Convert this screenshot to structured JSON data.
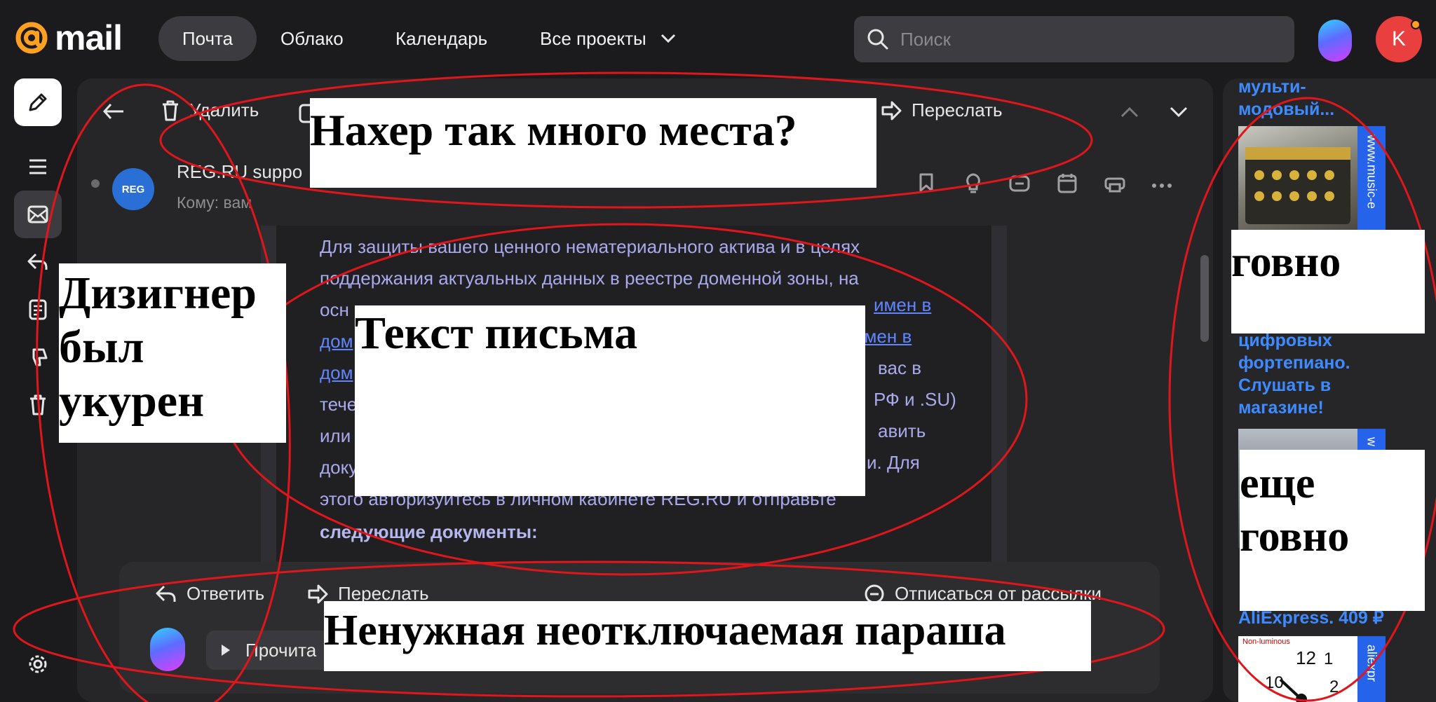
{
  "header": {
    "logo_text": "mail",
    "nav": [
      "Почта",
      "Облако",
      "Календарь",
      "Все проекты"
    ],
    "search_placeholder": "Поиск",
    "avatar_letter": "K"
  },
  "toolbar": {
    "delete_label": "Удалить",
    "forward_label": "Переслать"
  },
  "message": {
    "sender": "REG.RU suppo",
    "recipient": "Кому: вам",
    "sender_badge": "REG",
    "body_lines": [
      {
        "text": "Для защиты вашего ценного нематериального актива и в целях",
        "link": false
      },
      {
        "text": "поддержания актуальных данных в реестре доменной зоны, на",
        "link": false
      },
      {
        "text": "осн",
        "link": false
      },
      {
        "text": "дом",
        "link": true
      },
      {
        "text": "дом",
        "link": true
      },
      {
        "text": "тече",
        "link": false
      },
      {
        "text": "или",
        "link": false
      },
      {
        "text": "доку",
        "link": false
      },
      {
        "text": "этого авторизуйтесь в личном кабинете REG.RU и отправьте",
        "link": false
      }
    ],
    "body_fragments": [
      "имен в",
      "имен в",
      "вас в",
      "РФ и .SU)",
      "авить",
      "и. Для"
    ],
    "body_bold": "следующие документы:"
  },
  "bottom_bar": {
    "reply_label": "Ответить",
    "forward_label": "Переслать",
    "unsubscribe_label": "Отписаться от рассылки",
    "read_label": "Прочита"
  },
  "ads": {
    "ad1_text": "мульти-\nмодовый...",
    "ad1_side": "www.music-e",
    "ad2_text": "цифровых\nфортепиано.\nСлушать в\nмагазине!",
    "ad3_side": "w",
    "ad4_text": "AliExpress. 409 ₽",
    "ad4_side": "aliexpr",
    "ad4_label": "Non-luminous"
  },
  "annotations": {
    "top": "Нахер так много места?",
    "left_1": "Дизигнер",
    "left_2": "был",
    "left_3": "укурен",
    "center": "Текст письма",
    "right_1": "говно",
    "right_2": "еще",
    "right_3": "говно",
    "bottom": "Ненужная неотключаемая параша"
  },
  "colors": {
    "background": "#1b1b1d",
    "panel": "#262628",
    "accent_orange": "#ffa020",
    "link_blue": "#5f86ff",
    "ad_blue": "#3e8bff",
    "annotation_red": "#e0161b"
  }
}
